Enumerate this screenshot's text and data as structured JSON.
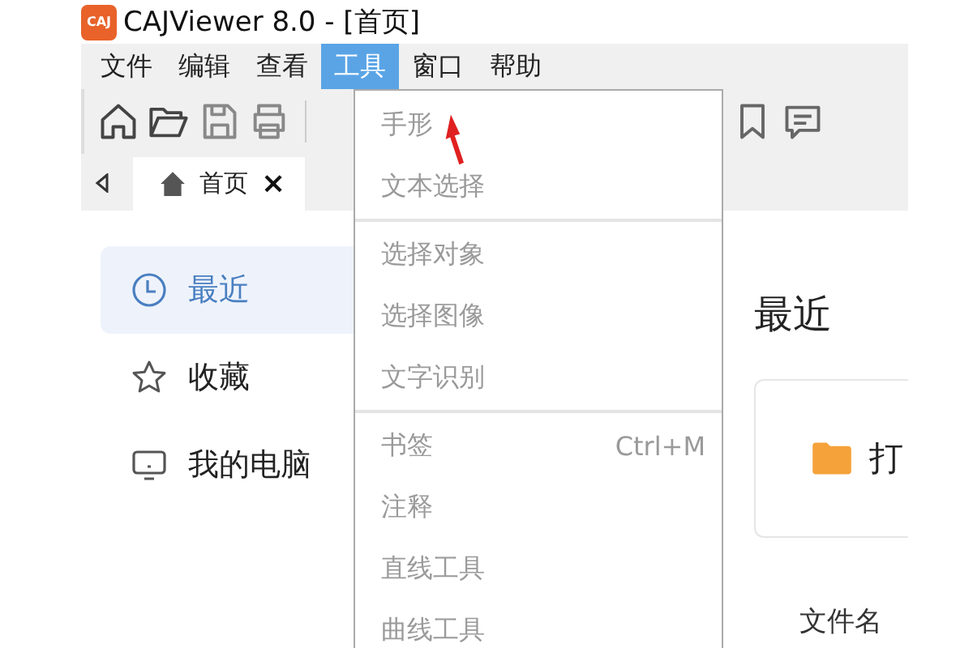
{
  "window": {
    "title": "CAJViewer 8.0 - [首页]",
    "logo": "CAJ"
  },
  "menu_bar": [
    {
      "label": "文件",
      "selected": false
    },
    {
      "label": "编辑",
      "selected": false
    },
    {
      "label": "查看",
      "selected": false
    },
    {
      "label": "工具",
      "selected": true
    },
    {
      "label": "窗口",
      "selected": false
    },
    {
      "label": "帮助",
      "selected": false
    }
  ],
  "dropdown": [
    {
      "kind": "item",
      "label": "手形",
      "disabled": true
    },
    {
      "kind": "item",
      "label": "文本选择",
      "disabled": true
    },
    {
      "kind": "separator"
    },
    {
      "kind": "item",
      "label": "选择对象",
      "disabled": true
    },
    {
      "kind": "item",
      "label": "选择图像",
      "disabled": true
    },
    {
      "kind": "item",
      "label": "文字识别",
      "disabled": true
    },
    {
      "kind": "separator"
    },
    {
      "kind": "item",
      "label": "书签",
      "shortcut": "Ctrl+M",
      "disabled": true
    },
    {
      "kind": "item",
      "label": "注释",
      "disabled": true
    },
    {
      "kind": "item",
      "label": "直线工具",
      "disabled": true
    },
    {
      "kind": "item",
      "label": "曲线工具",
      "disabled": true
    }
  ],
  "tabs": [
    {
      "label": "首页",
      "close": "×",
      "selected": true
    }
  ],
  "sidebar": {
    "items": [
      {
        "label": "最近",
        "selected": true
      },
      {
        "label": "收藏",
        "selected": false
      },
      {
        "label": "我的电脑",
        "selected": false
      }
    ]
  },
  "main": {
    "heading": "最近",
    "open_card": {
      "label": "打"
    },
    "column_header": "文件名"
  }
}
